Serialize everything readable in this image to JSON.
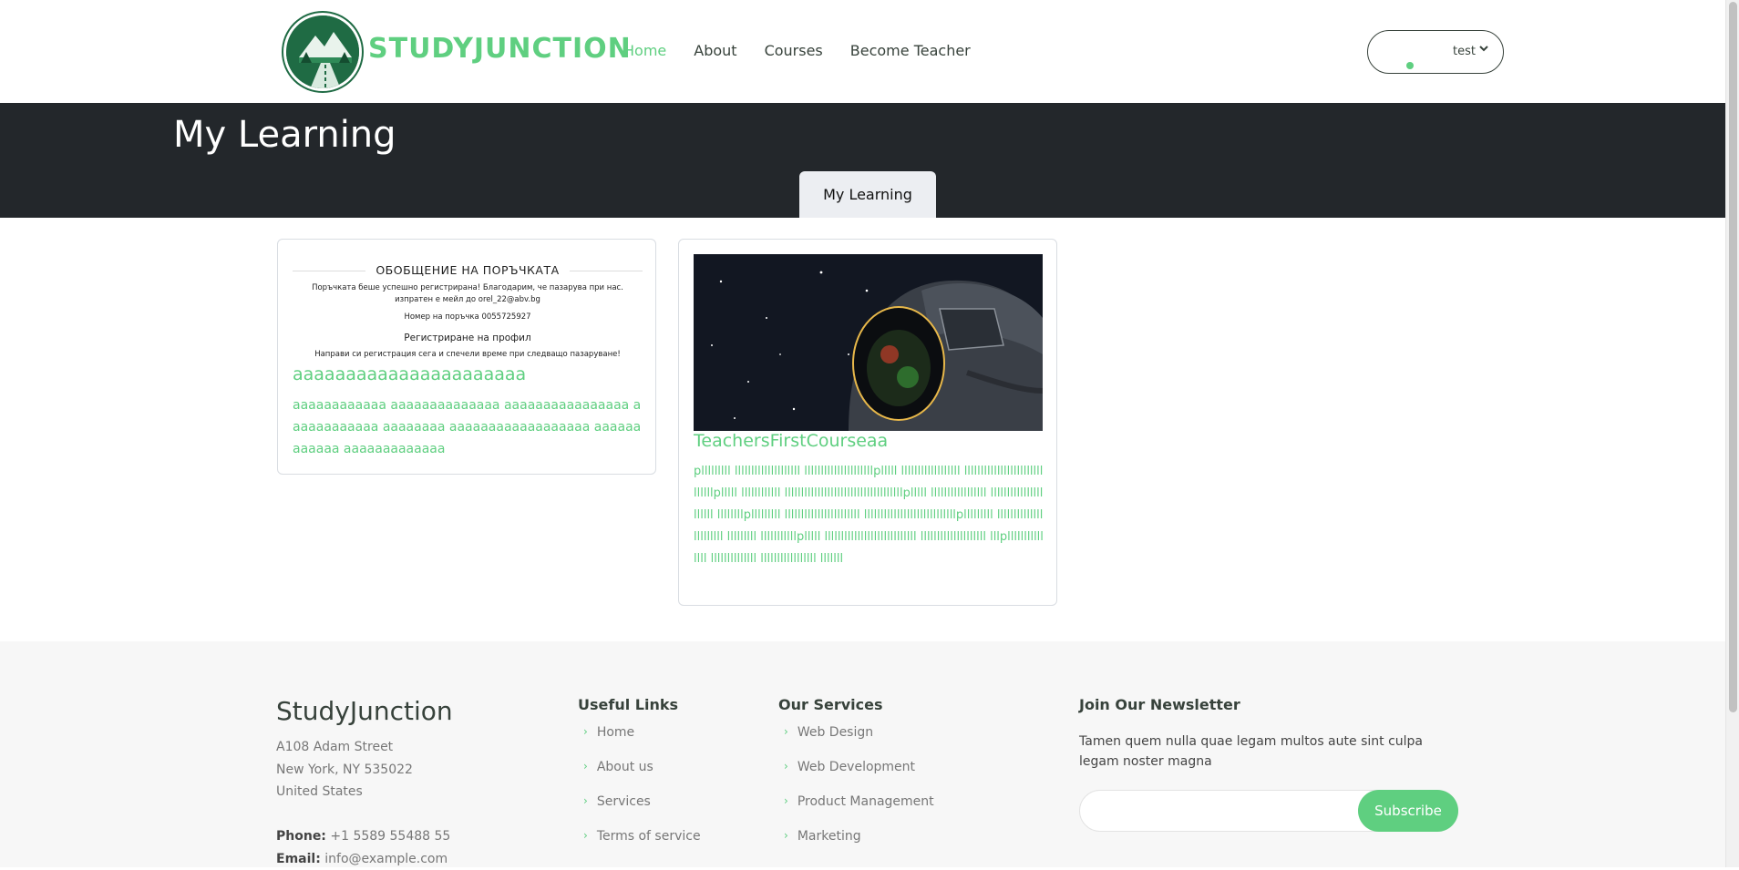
{
  "header": {
    "brand": "STUDYJUNCTION",
    "nav": [
      "Home",
      "About",
      "Courses",
      "Become Teacher"
    ],
    "user_name": "test",
    "accent": "#5fcf80"
  },
  "band": {
    "title": "My Learning",
    "tab": "My Learning",
    "bg": "#23272b"
  },
  "courses": [
    {
      "receipt": {
        "heading": "ОБОБЩЕНИЕ НА ПОРЪЧКАТА",
        "line1": "Поръчката беше успешно регистрирана! Благодарим, че пазарува при нас.",
        "line2": "изпратен е мейл до orel_22@abv.bg",
        "line3": "Номер на поръчка 0055725927",
        "sub": "Регистриране на профил",
        "line4": "Направи си регистрация сега и спечели време при следващо пазаруване!"
      },
      "title": "aaaaaaaaaaaaaaaaaaaaaa",
      "description": "aaaaaaaaaaaa aaaaaaaaaaaaaa aaaaaaaaaaaaaaaa aaaaaaaaaaaa aaaaaaaa aaaaaaaaaaaaaaaaaa aaaaaaaaaaaa aaaaaaaaaaaaa"
    },
    {
      "title": "TeachersFirstCourseaa",
      "description": "plllllllll llllllllllllllllllll lllllllllllllllllllllplllll llllllllllllllllll llllllllllllllllllllllllllllllplllll llllllllllll llllllllllllllllllllllllllllllllllllplllll lllllllllllllllll llllllllllllllllllllll llllllllplllllllll lllllllllllllllllllllll llllllllllllllllllllllllllllplllllllll lllllllllllllllllllllll lllllllll lllllllllllplllll llllllllllllllllllllllllllll llllllllllllllllllll lllplllllllllllllll llllllllllllll lllllllllllllllll lllllll"
    }
  ],
  "footer": {
    "brand": "StudyJunction",
    "address": [
      "A108 Adam Street",
      "New York, NY 535022",
      "United States"
    ],
    "phone_label": "Phone:",
    "phone": "+1 5589 55488 55",
    "email_label": "Email:",
    "email": "info@example.com",
    "useful_links_title": "Useful Links",
    "useful_links": [
      "Home",
      "About us",
      "Services",
      "Terms of service"
    ],
    "services_title": "Our Services",
    "services": [
      "Web Design",
      "Web Development",
      "Product Management",
      "Marketing"
    ],
    "newsletter_title": "Join Our Newsletter",
    "newsletter_text": "Tamen quem nulla quae legam multos aute sint culpa legam noster magna",
    "subscribe": "Subscribe"
  }
}
